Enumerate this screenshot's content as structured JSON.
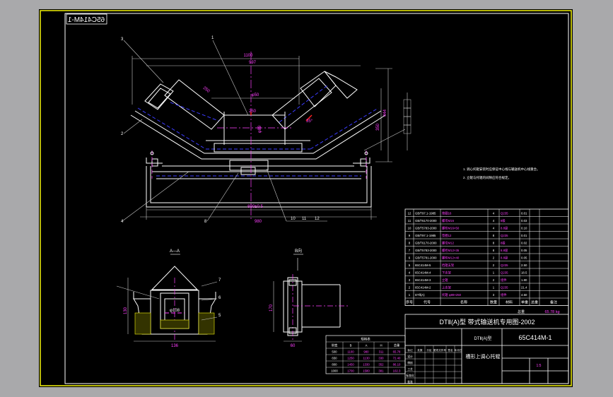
{
  "drawing_code": "65C414M-1",
  "drawing_code_mirrored": "65C414M-1",
  "title_block": {
    "series_title": "DTⅡ(A)型 带式输送机专用图-2002",
    "name": "槽形上调心托辊",
    "standard": "DTⅡ(A)型",
    "code": "65C414M-1",
    "mass_label": "总重",
    "mass_value": "65.78 kg",
    "col_headers": [
      "序号",
      "代号",
      "名称",
      "数量",
      "材料",
      "单重",
      "总重",
      "备注"
    ],
    "footer_headers": [
      "标记",
      "处数",
      "分区",
      "更改文件号",
      "签名",
      "年月日"
    ],
    "role_rows": [
      "设计",
      "审核",
      "工艺",
      "标准化",
      "批准"
    ],
    "scale": "1:5"
  },
  "parts_list": [
    {
      "no": "12",
      "code": "GB/T97.1-1985",
      "name": "垫圈16",
      "qty": "4",
      "material": "Q235",
      "unit": "0.01"
    },
    {
      "no": "11",
      "code": "GB/T6170-2000",
      "name": "螺母M16",
      "qty": "4",
      "material": "8级",
      "unit": "0.03"
    },
    {
      "no": "10",
      "code": "GB/T5783-2000",
      "name": "螺栓M16×50",
      "qty": "4",
      "material": "8.8级",
      "unit": "0.10"
    },
    {
      "no": "9",
      "code": "GB/T97.1-1985",
      "name": "垫圈12",
      "qty": "8",
      "material": "Q235",
      "unit": "0.01"
    },
    {
      "no": "8",
      "code": "GB/T6170-2000",
      "name": "螺母M12",
      "qty": "8",
      "material": "8级",
      "unit": "0.02"
    },
    {
      "no": "7",
      "code": "GB/T5783-2000",
      "name": "螺栓M12×35",
      "qty": "8",
      "material": "8.8级",
      "unit": "0.05"
    },
    {
      "no": "6",
      "code": "GB/T5781-2000",
      "name": "螺栓M12×40",
      "qty": "2",
      "material": "8.8级",
      "unit": "0.05"
    },
    {
      "no": "5",
      "code": "65C414M-5",
      "name": "挡辊支架",
      "qty": "2",
      "material": "Q235",
      "unit": "2.50"
    },
    {
      "no": "4",
      "code": "65C414M-4",
      "name": "下支架",
      "qty": "1",
      "material": "Q235",
      "unit": "18.5"
    },
    {
      "no": "3",
      "code": "65C414M-3",
      "name": "立辊",
      "qty": "2",
      "material": "组件",
      "unit": "1.80"
    },
    {
      "no": "2",
      "code": "65C414M-2",
      "name": "上支架",
      "qty": "1",
      "material": "Q235",
      "unit": "21.4"
    },
    {
      "no": "1",
      "code": "DTⅡ(A)",
      "name": "托辊 φ89×250",
      "qty": "3",
      "material": "组件",
      "unit": "4.50"
    }
  ],
  "specs_table": {
    "title": "规格表",
    "headers": [
      "带宽",
      "B",
      "A",
      "H",
      "总重"
    ],
    "rows": [
      [
        "500",
        "1100",
        "980",
        "311",
        "65.78"
      ],
      [
        "650",
        "1250",
        "1130",
        "330",
        "72.40"
      ],
      [
        "800",
        "1450",
        "1330",
        "352",
        "86.10"
      ],
      [
        "1000",
        "1700",
        "1580",
        "381",
        "102.3"
      ]
    ]
  },
  "notes": [
    "1. 调心托辊安装时应保证中心线与输送机中心线重合。",
    "2. 立辊与托辊的间隙应符合规定。"
  ],
  "dimensions": {
    "overall_width": "1100",
    "top_width": "997",
    "seat_width": "φ50",
    "roller_span": "250",
    "base_length": "880±0.5",
    "base_width": "980",
    "height_total": "444",
    "height_mid": "350",
    "angle": "35°",
    "roller_dia": "φ89",
    "side_label": "250",
    "detail_height": "130",
    "detail_width": "136",
    "detail_dia": "φ108",
    "side_height": "170",
    "side_width": "60"
  },
  "section_labels": {
    "a": "A—A",
    "b": "B向"
  },
  "callouts": [
    "1",
    "2",
    "3",
    "4",
    "5",
    "6",
    "7",
    "8",
    "10",
    "11",
    "12"
  ],
  "colors": {
    "paper": "#000000",
    "frame": "#f2f20a",
    "line": "#ffffff",
    "dim": "#c8c8c8",
    "text": "#ff3fff",
    "axis": "#ff3fff",
    "hidden": "#3b3bff",
    "cut": "#ff2222",
    "parts": "#ffffff"
  }
}
